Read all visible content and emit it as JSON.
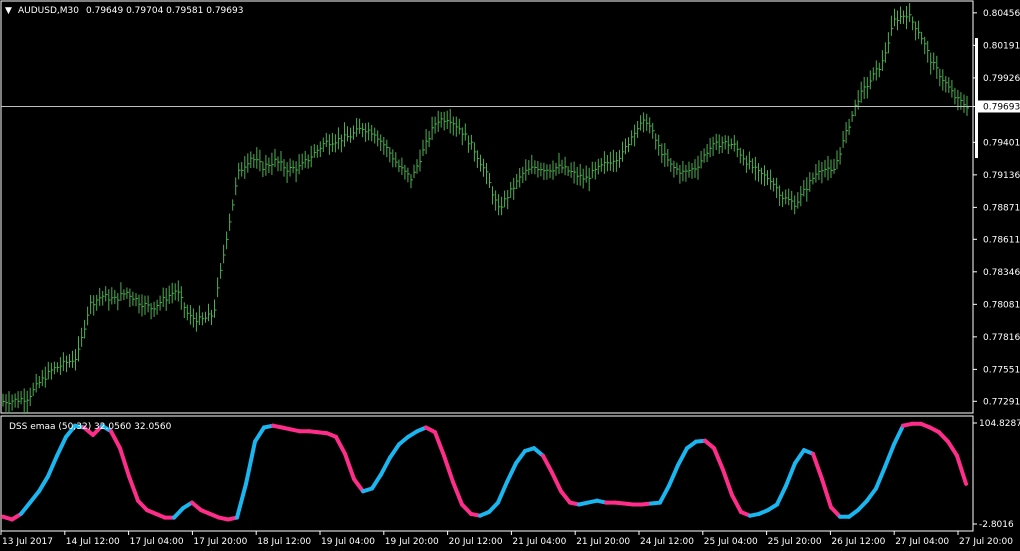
{
  "symbol_header": {
    "arrow": "▼",
    "symbol": "AUDUSD,M30",
    "ohlc": "0.79649 0.79704 0.79581 0.79693"
  },
  "indicator_header": "DSS emaa (50,32) 32.0560 32.0560",
  "current_price_label": "0.79693",
  "colors": {
    "background": "#000000",
    "frame": "#ffffff",
    "bars": "#4caf50",
    "grid_line": "#c0c0c0",
    "dss_up": "#1ab6f0",
    "dss_down": "#ff2d8a"
  },
  "chart_data": [
    {
      "type": "bar",
      "name": "price",
      "title": "AUDUSD,M30",
      "ylim": [
        0.7722,
        0.8052
      ],
      "y_ticks": [
        "0.80456",
        "0.80191",
        "0.79926",
        "0.79693",
        "0.79401",
        "0.79136",
        "0.78871",
        "0.78611",
        "0.78346",
        "0.78081",
        "0.77816",
        "0.77551",
        "0.77291"
      ],
      "current_price": 0.79693,
      "x_ticks": [
        "13 Jul 2017",
        "14 Jul 12:00",
        "17 Jul 04:00",
        "17 Jul 20:00",
        "18 Jul 12:00",
        "19 Jul 04:00",
        "19 Jul 20:00",
        "20 Jul 12:00",
        "21 Jul 04:00",
        "21 Jul 20:00",
        "24 Jul 12:00",
        "25 Jul 04:00",
        "25 Jul 20:00",
        "26 Jul 12:00",
        "27 Jul 04:00",
        "27 Jul 20:00"
      ],
      "close_path": [
        0.7729,
        0.773,
        0.7732,
        0.7745,
        0.7755,
        0.776,
        0.7765,
        0.7808,
        0.7815,
        0.7812,
        0.7818,
        0.781,
        0.7805,
        0.7812,
        0.782,
        0.7798,
        0.7795,
        0.78,
        0.786,
        0.7915,
        0.7928,
        0.792,
        0.7925,
        0.7918,
        0.792,
        0.793,
        0.794,
        0.7942,
        0.7945,
        0.7952,
        0.7948,
        0.7935,
        0.792,
        0.791,
        0.7935,
        0.7958,
        0.796,
        0.795,
        0.7935,
        0.7915,
        0.7885,
        0.79,
        0.7915,
        0.792,
        0.7918,
        0.792,
        0.7915,
        0.791,
        0.7918,
        0.7925,
        0.793,
        0.795,
        0.7958,
        0.7935,
        0.792,
        0.7915,
        0.792,
        0.7935,
        0.794,
        0.7938,
        0.7925,
        0.7915,
        0.791,
        0.7895,
        0.789,
        0.7905,
        0.792,
        0.7915,
        0.7945,
        0.7975,
        0.799,
        0.8005,
        0.804,
        0.8045,
        0.803,
        0.8005,
        0.799,
        0.7975,
        0.7969
      ]
    },
    {
      "type": "line",
      "name": "DSS emaa (50,32)",
      "ylim": [
        -2.8016,
        104.8287
      ],
      "y_ticks": [
        "104.8287",
        "-2.8016"
      ],
      "last_values": [
        32.056,
        32.056
      ],
      "values": [
        5,
        2,
        8,
        20,
        32,
        48,
        70,
        90,
        102,
        100,
        92,
        102,
        96,
        78,
        48,
        22,
        12,
        8,
        4,
        4,
        14,
        20,
        12,
        8,
        4,
        2,
        4,
        40,
        85,
        100,
        102,
        100,
        98,
        96,
        96,
        95,
        94,
        90,
        72,
        45,
        32,
        35,
        50,
        68,
        82,
        90,
        96,
        100,
        95,
        70,
        42,
        18,
        8,
        6,
        10,
        20,
        42,
        62,
        75,
        78,
        70,
        52,
        32,
        20,
        18,
        20,
        22,
        20,
        20,
        19,
        18,
        18,
        19,
        20,
        38,
        60,
        78,
        85,
        86,
        78,
        55,
        28,
        10,
        6,
        8,
        12,
        18,
        38,
        62,
        76,
        72,
        45,
        15,
        5,
        5,
        12,
        22,
        35,
        58,
        82,
        102,
        104,
        104,
        100,
        95,
        85,
        70,
        40
      ],
      "colors_by_segment": [
        "down",
        "down",
        "up",
        "up",
        "up",
        "up",
        "up",
        "up",
        "up",
        "down",
        "down",
        "up",
        "down",
        "down",
        "down",
        "down",
        "down",
        "down",
        "down",
        "up",
        "up",
        "down",
        "down",
        "down",
        "down",
        "down",
        "up",
        "up",
        "up",
        "up",
        "down",
        "down",
        "down",
        "down",
        "down",
        "down",
        "down",
        "down",
        "down",
        "down",
        "up",
        "up",
        "up",
        "up",
        "up",
        "up",
        "up",
        "down",
        "down",
        "down",
        "down",
        "down",
        "down",
        "up",
        "up",
        "up",
        "up",
        "up",
        "up",
        "up",
        "down",
        "down",
        "down",
        "down",
        "up",
        "up",
        "up",
        "down",
        "down",
        "down",
        "down",
        "down",
        "up",
        "up",
        "up",
        "up",
        "up",
        "up",
        "down",
        "down",
        "down",
        "down",
        "down",
        "up",
        "up",
        "up",
        "up",
        "up",
        "up",
        "up",
        "down",
        "down",
        "down",
        "up",
        "up",
        "up",
        "up",
        "up",
        "up",
        "up",
        "down",
        "down",
        "down",
        "down",
        "down",
        "down",
        "down"
      ]
    }
  ]
}
